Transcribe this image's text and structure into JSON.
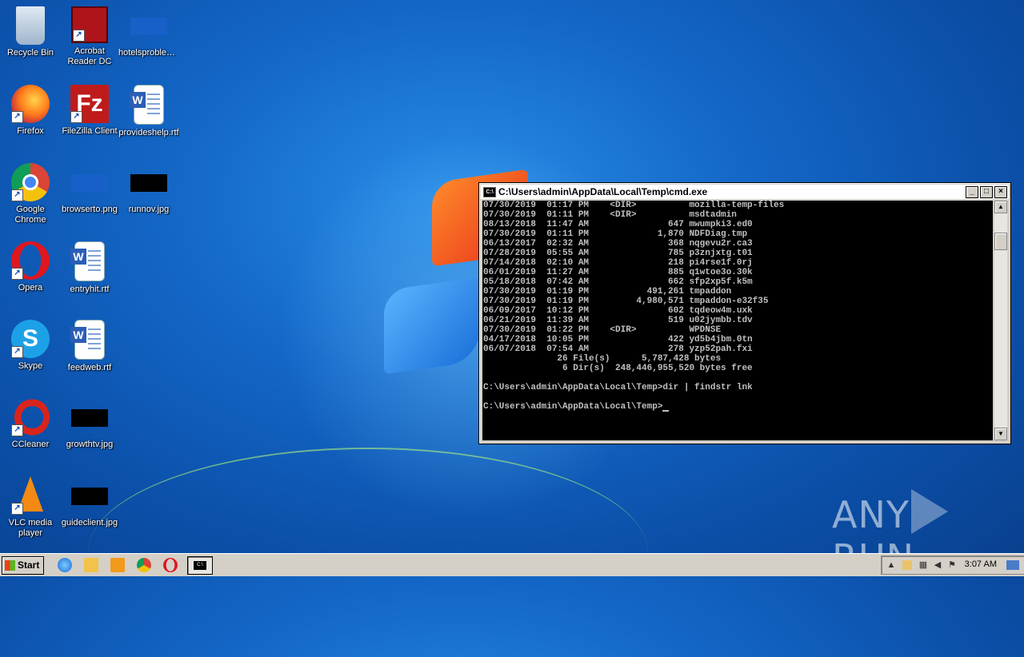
{
  "desktop": {
    "icons": [
      {
        "label": "Recycle Bin"
      },
      {
        "label": "Acrobat Reader DC"
      },
      {
        "label": "hotelsproblem.png"
      },
      {
        "label": "Firefox"
      },
      {
        "label": "FileZilla Client"
      },
      {
        "label": "provideshelp.rtf"
      },
      {
        "label": "Google Chrome"
      },
      {
        "label": "browserto.png"
      },
      {
        "label": "runnov.jpg"
      },
      {
        "label": "Opera"
      },
      {
        "label": "entryhit.rtf"
      },
      {
        "label": "Skype"
      },
      {
        "label": "feedweb.rtf"
      },
      {
        "label": "CCleaner"
      },
      {
        "label": "growthtv.jpg"
      },
      {
        "label": "VLC media player"
      },
      {
        "label": "guideclient.jpg"
      }
    ]
  },
  "cmd_window": {
    "title": "C:\\Users\\admin\\AppData\\Local\\Temp\\cmd.exe",
    "output": "07/30/2019  01:17 PM    <DIR>          mozilla-temp-files\n07/30/2019  01:11 PM    <DIR>          msdtadmin\n08/13/2018  11:47 AM               647 mwumpki3.ed0\n07/30/2019  01:11 PM             1,870 NDFDiag.tmp\n06/13/2017  02:32 AM               368 nqgevu2r.ca3\n07/28/2019  05:55 AM               785 p3znjxtg.t01\n07/14/2018  02:10 AM               218 pi4rse1f.0rj\n06/01/2019  11:27 AM               885 q1wtoe3o.30k\n05/18/2018  07:42 AM               662 sfp2xp5f.k5m\n07/30/2019  01:19 PM           491,261 tmpaddon\n07/30/2019  01:19 PM         4,980,571 tmpaddon-e32f35\n06/09/2017  10:12 PM               602 tqdeow4m.uxk\n06/21/2019  11:39 AM               519 u02jymbb.tdv\n07/30/2019  01:22 PM    <DIR>          WPDNSE\n04/17/2018  10:05 PM               422 yd5b4jbm.0tn\n06/07/2018  07:54 AM               278 yzp52pah.fxi\n              26 File(s)      5,787,428 bytes\n               6 Dir(s)  248,446,955,520 bytes free\n\nC:\\Users\\admin\\AppData\\Local\\Temp>dir | findstr lnk\n\nC:\\Users\\admin\\AppData\\Local\\Temp>",
    "controls": {
      "minimize": "_",
      "maximize": "□",
      "close": "×"
    }
  },
  "watermark": {
    "left": "ANY",
    "right": "RUN"
  },
  "taskbar": {
    "start_label": "Start",
    "clock": "3:07 AM"
  }
}
